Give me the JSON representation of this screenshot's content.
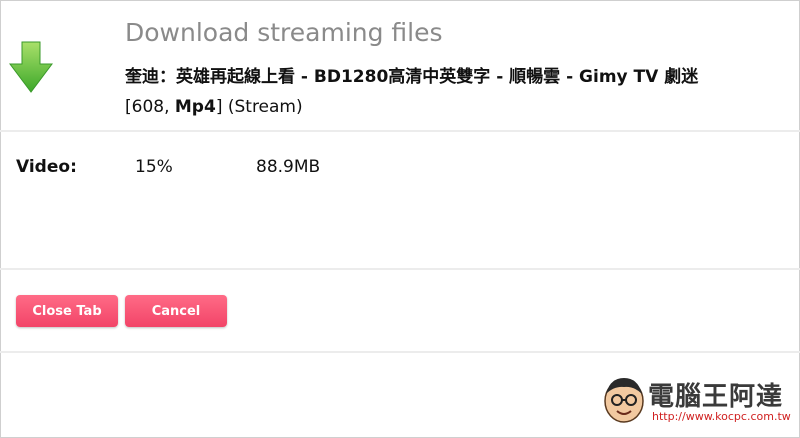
{
  "dialog": {
    "title": "Download streaming files",
    "subtitle": "奎迪：英雄再起線上看 - BD1280高清中英雙字 - 順暢雲 - Gimy TV 劇迷",
    "meta_prefix": "[608, ",
    "meta_format": "Mp4",
    "meta_suffix": "] (Stream)",
    "icon": "download-arrow-icon"
  },
  "progress": {
    "label": "Video:",
    "percent": "15%",
    "size": "88.9MB"
  },
  "buttons": {
    "close_tab": "Close Tab",
    "cancel": "Cancel"
  },
  "watermark": {
    "name": "電腦王阿達",
    "url": "http://www.kocpc.com.tw"
  },
  "colors": {
    "accent": "#f24468",
    "arrow": "#5cc23a",
    "title": "#8a8a8a"
  }
}
